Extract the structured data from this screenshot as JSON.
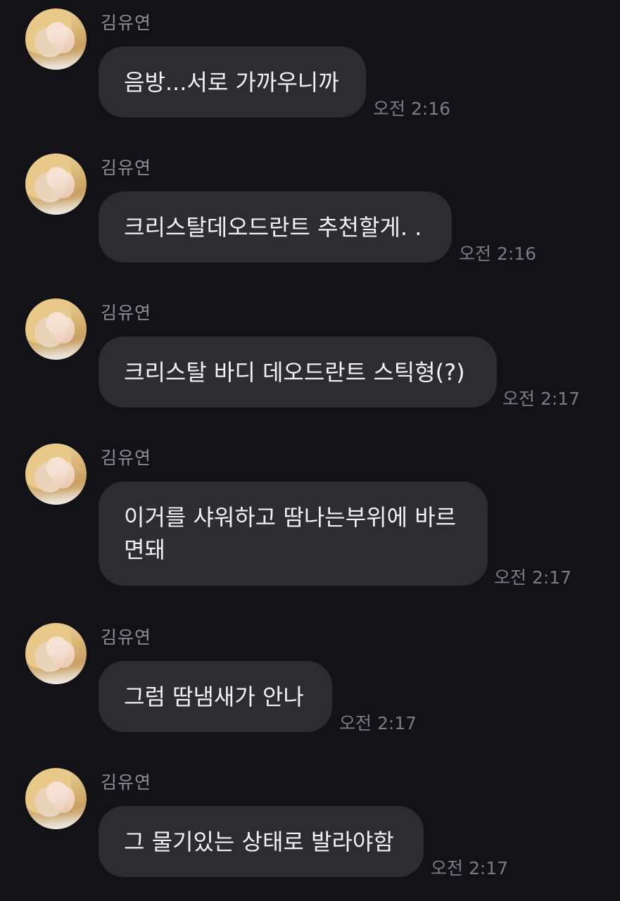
{
  "messages": [
    {
      "sender": "김유연",
      "text": "음방...서로 가까우니까",
      "time": "오전 2:16"
    },
    {
      "sender": "김유연",
      "text": "크리스탈데오드란트 추천할게. .",
      "time": "오전 2:16"
    },
    {
      "sender": "김유연",
      "text": "크리스탈 바디 데오드란트 스틱형(?)",
      "time": "오전 2:17"
    },
    {
      "sender": "김유연",
      "text": "이거를 샤워하고 땀나는부위에 바르\n면돼",
      "time": "오전 2:17"
    },
    {
      "sender": "김유연",
      "text": "그럼 땀냄새가 안나",
      "time": "오전 2:17"
    },
    {
      "sender": "김유연",
      "text": "그 물기있는 상태로 발라야함",
      "time": "오전 2:17"
    }
  ],
  "colors": {
    "background": "#131317",
    "bubble": "#2c2c31",
    "name": "#8d8d93",
    "time": "#7b7b82"
  }
}
